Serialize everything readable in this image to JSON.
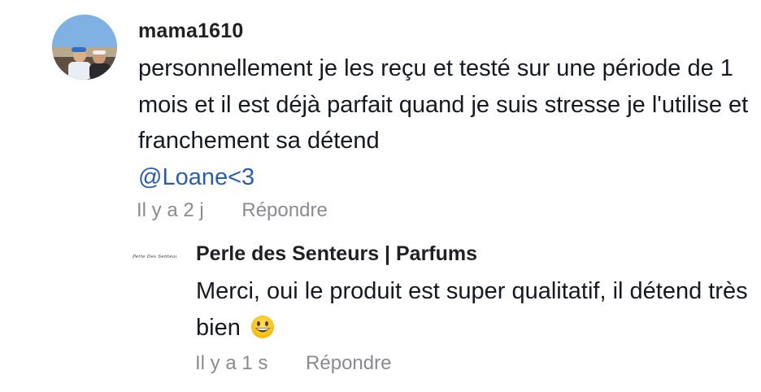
{
  "comment": {
    "username": "mama1610",
    "text": "personnellement je les reçu et testé sur une période de 1 mois et il est déjà parfait quand je suis stresse je l'utilise et franchement sa détend",
    "mention": "@Loane<3",
    "time": "Il y a 2 j",
    "reply_label": "Répondre",
    "mention_color": "#2b5dab"
  },
  "reply": {
    "username": "Perle des Senteurs | Parfums",
    "avatar_text": "Perle Des Senteurs",
    "text": "Merci, oui le produit est super qualitatif, il détend très bien",
    "emoji": "grinning-face-emoji",
    "time": "Il y a 1 s",
    "reply_label": "Répondre"
  },
  "colors": {
    "text": "#161823",
    "meta": "#8a8b91",
    "background": "#ffffff"
  }
}
